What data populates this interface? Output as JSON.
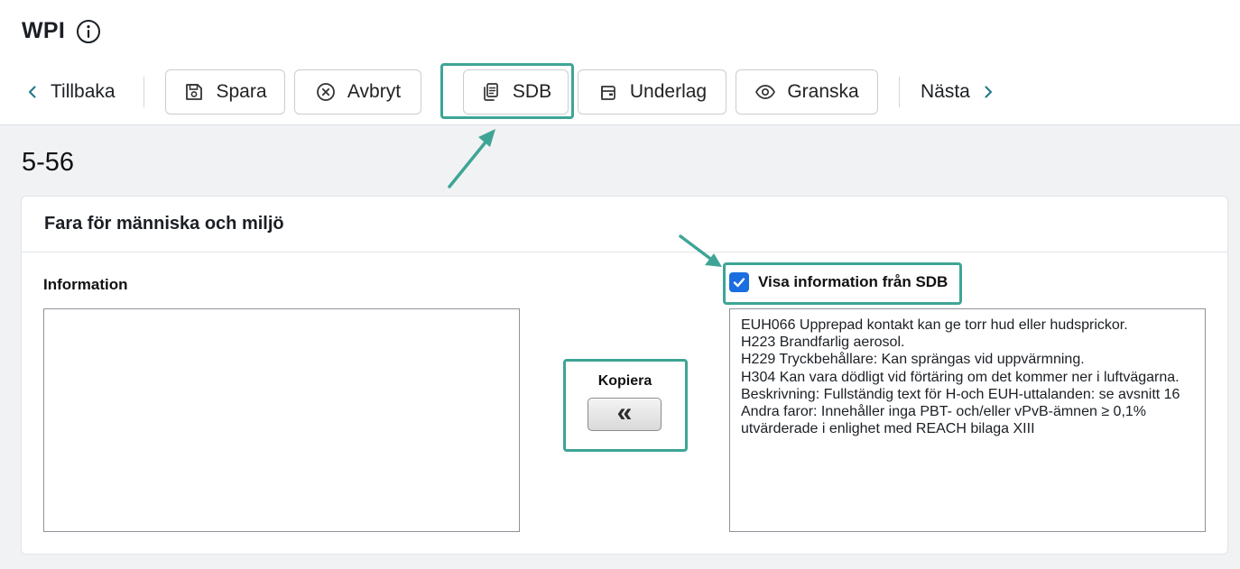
{
  "app": {
    "title": "WPI"
  },
  "toolbar": {
    "back_label": "Tillbaka",
    "save_label": "Spara",
    "cancel_label": "Avbryt",
    "sdb_label": "SDB",
    "underlag_label": "Underlag",
    "review_label": "Granska",
    "next_label": "Nästa"
  },
  "page": {
    "section_number": "5-56"
  },
  "card": {
    "title": "Fara för människa och miljö",
    "info_label": "Information",
    "info_value": "",
    "copy_label": "Kopiera",
    "copy_glyph": "«",
    "sdb_checkbox_label": "Visa information från SDB",
    "sdb_checkbox_checked": true,
    "sdb_lines": [
      "EUH066 Upprepad kontakt kan ge torr hud eller hudsprickor.",
      "H223 Brandfarlig aerosol.",
      "H229 Tryckbehållare: Kan sprängas vid uppvärmning.",
      "H304 Kan vara dödligt vid förtäring om det kommer ner i luftvägarna.",
      "Beskrivning: Fullständig text för H-och EUH-uttalanden: se avsnitt 16",
      "Andra faror: Innehåller inga PBT- och/eller vPvB-ämnen ≥ 0,1% utvärderade i enlighet med REACH bilaga XIII"
    ]
  },
  "colors": {
    "accent": "#3ea596",
    "checkbox": "#1a6ee0"
  }
}
